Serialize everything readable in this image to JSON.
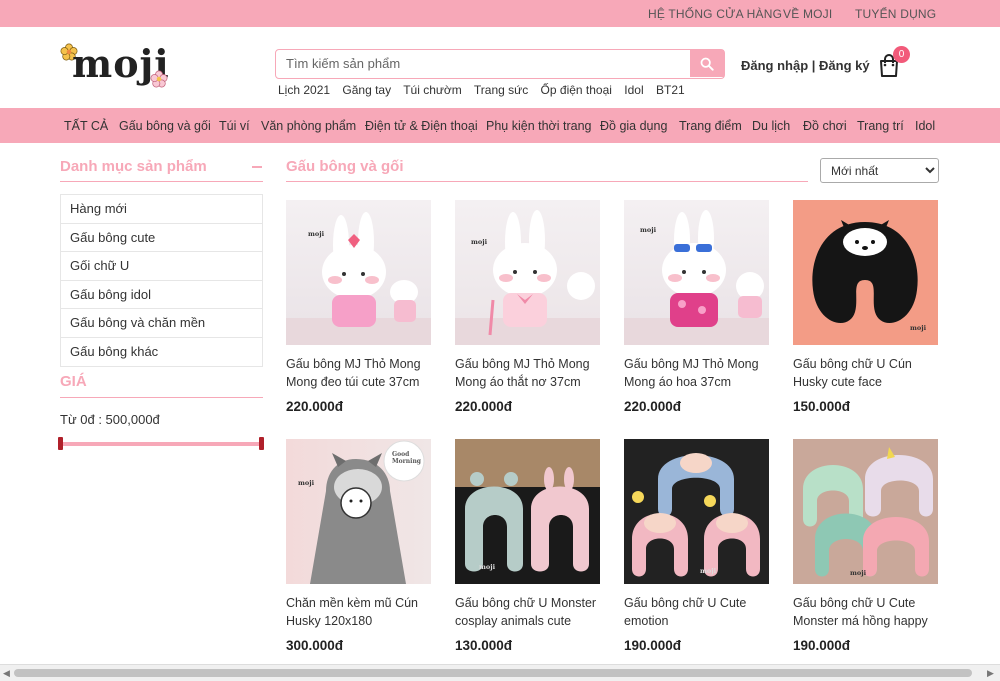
{
  "topbar": {
    "links": [
      "HỆ THỐNG CỬA HÀNG",
      "VỀ MOJI",
      "TUYỂN DỤNG"
    ]
  },
  "header": {
    "logo_text": "moji",
    "search_placeholder": "Tìm kiếm sản phẩm",
    "quick_links": [
      "Lịch 2021",
      "Găng tay",
      "Túi chườm",
      "Trang sức",
      "Ốp điện thoại",
      "Idol",
      "BT21"
    ],
    "auth_text": "Đăng nhập | Đăng ký",
    "cart_count": "0"
  },
  "nav": {
    "items": [
      "TẤT CẢ",
      "Gấu bông và gối",
      "Túi ví",
      "Văn phòng phẩm",
      "Điện tử & Điện thoại",
      "Phụ kiện thời trang",
      "Đồ gia dụng",
      "Trang điểm",
      "Du lịch",
      "Đồ chơi",
      "Trang trí",
      "Idol"
    ]
  },
  "sidebar": {
    "title": "Danh mục sản phẩm",
    "categories": [
      "Hàng mới",
      "Gấu bông cute",
      "Gối chữ U",
      "Gấu bông idol",
      "Gấu bông và chăn mền",
      "Gấu bông khác"
    ],
    "price_title": "GIÁ",
    "price_range": "Từ 0đ : 500,000đ"
  },
  "content": {
    "title": "Gấu bông và gối",
    "sort_selected": "Mới nhất",
    "products": [
      {
        "name": "Gấu bông MJ Thỏ Mong Mong đeo túi cute 37cm",
        "price": "220.000đ"
      },
      {
        "name": "Gấu bông MJ Thỏ Mong Mong áo thắt nơ 37cm",
        "price": "220.000đ"
      },
      {
        "name": "Gấu bông MJ Thỏ Mong Mong áo hoa 37cm",
        "price": "220.000đ"
      },
      {
        "name": "Gấu bông chữ U Cún Husky cute face",
        "price": "150.000đ"
      },
      {
        "name": "Chăn mền kèm mũ Cún Husky 120x180",
        "price": "300.000đ"
      },
      {
        "name": "Gấu bông chữ U Monster cosplay animals cute",
        "price": "130.000đ"
      },
      {
        "name": "Gấu bông chữ U Cute emotion",
        "price": "190.000đ"
      },
      {
        "name": "Gấu bông chữ U Cute Monster má hồng happy",
        "price": "190.000đ"
      }
    ],
    "image_tag": "moji",
    "good_morning_note": "Good Morning"
  },
  "colors": {
    "brand_pink": "#f7a8b8",
    "badge": "#f25a7a",
    "slider_handle": "#b0202a"
  },
  "icons": {
    "search": "search-icon",
    "cart": "shopping-bag-icon",
    "collapse": "minus-icon"
  }
}
